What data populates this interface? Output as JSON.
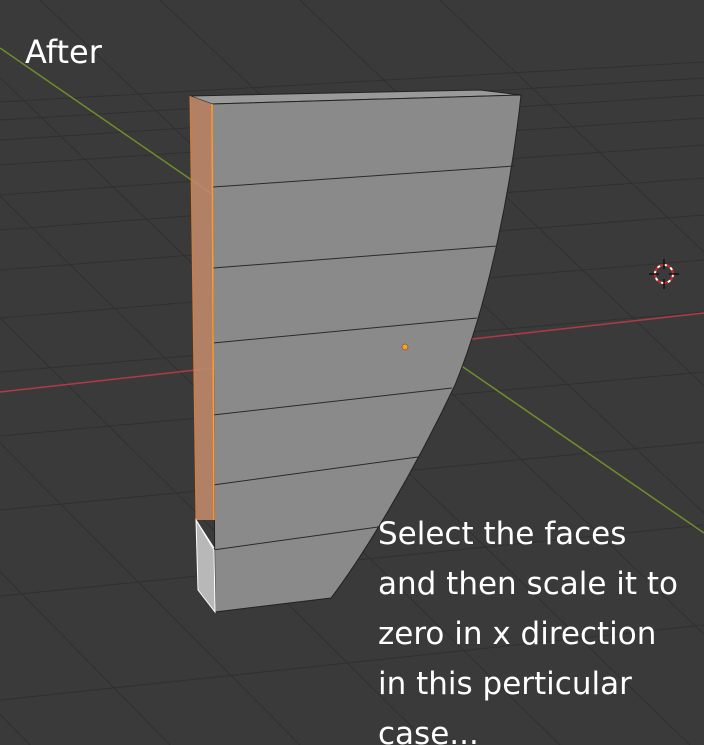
{
  "viewport": {
    "caption": "After",
    "annotation_lines": [
      "Select the faces",
      "and then scale it to",
      "zero in x direction",
      "in this perticular",
      "case..."
    ]
  },
  "colors": {
    "background": "#3a3a3a",
    "grid_line": "#303030",
    "x_axis": "#b03a48",
    "y_axis": "#6e8e2a",
    "mesh_face": "#8a8a8a",
    "selected_face": "#c08a6a",
    "selected_edge": "#ff9a2e",
    "origin_dot": "#ff9a2e",
    "text": "#ffffff"
  },
  "icons": {
    "cursor": "3d-cursor-icon",
    "origin": "origin-dot-icon"
  }
}
